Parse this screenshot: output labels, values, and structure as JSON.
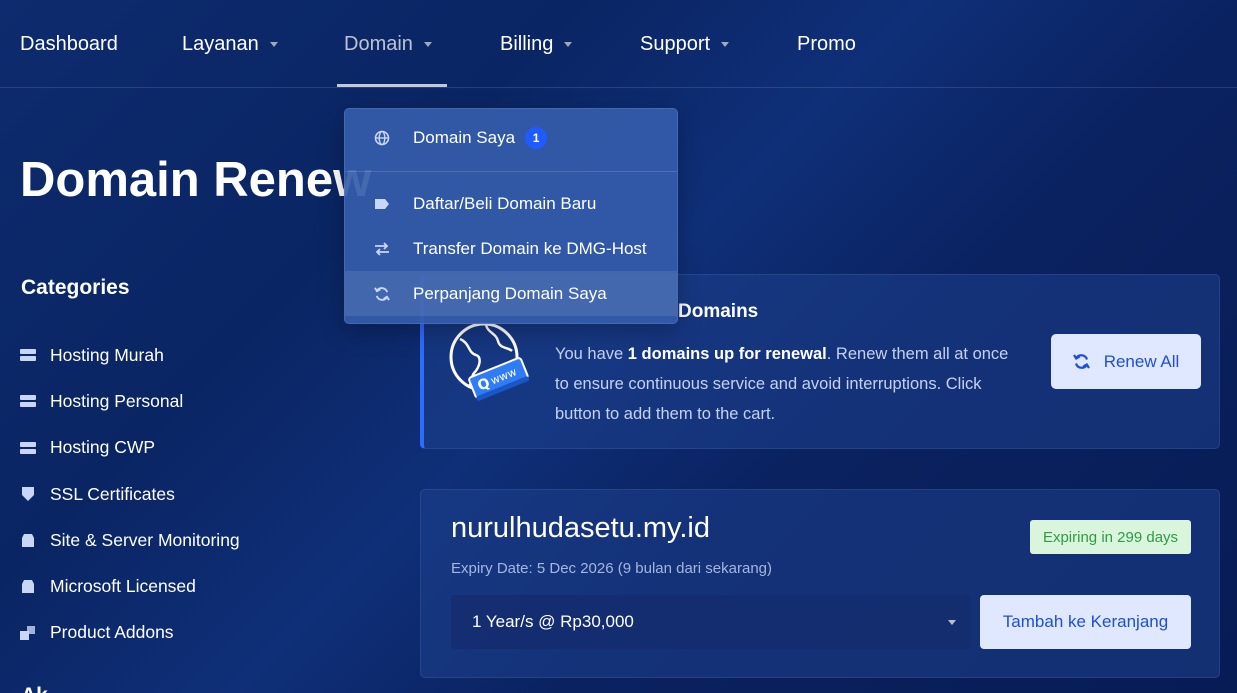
{
  "nav": {
    "items": [
      {
        "label": "Dashboard",
        "has_caret": false
      },
      {
        "label": "Layanan",
        "has_caret": true
      },
      {
        "label": "Domain",
        "has_caret": true,
        "active": true
      },
      {
        "label": "Billing",
        "has_caret": true
      },
      {
        "label": "Support",
        "has_caret": true
      },
      {
        "label": "Promo",
        "has_caret": false
      }
    ]
  },
  "dropdown": {
    "items": [
      {
        "label": "Domain Saya",
        "icon": "globe-icon",
        "badge": "1"
      },
      {
        "label": "Daftar/Beli Domain Baru",
        "icon": "tag-icon"
      },
      {
        "label": "Transfer Domain ke DMG-Host",
        "icon": "transfer-arrows-icon"
      },
      {
        "label": "Perpanjang Domain Saya",
        "icon": "sync-icon",
        "hovered": true
      }
    ]
  },
  "page": {
    "title": "Domain Renew"
  },
  "categories": {
    "title": "Categories",
    "items": [
      {
        "label": "Hosting Murah",
        "icon": "server-icon"
      },
      {
        "label": "Hosting Personal",
        "icon": "server-icon"
      },
      {
        "label": "Hosting CWP",
        "icon": "server-icon"
      },
      {
        "label": "SSL Certificates",
        "icon": "shield-icon"
      },
      {
        "label": "Site & Server Monitoring",
        "icon": "box-icon"
      },
      {
        "label": "Microsoft Licensed",
        "icon": "box-icon"
      },
      {
        "label": "Product Addons",
        "icon": "cubes-icon"
      }
    ],
    "next_section_title": "Ak"
  },
  "renew_card": {
    "title": "Domains",
    "text_prefix": "You have ",
    "text_bold": "1 domains up for renewal",
    "text_suffix": ". Renew them all at once to ensure continuous service and avoid interruptions. Click button to add them to the cart.",
    "button_label": "Renew All",
    "illustration": "globe-www-icon"
  },
  "domain_card": {
    "domain": "nurulhudasetu.my.id",
    "expiry": "Expiry Date: 5 Dec 2026 (9 bulan dari sekarang)",
    "badge": "Expiring in 299 days",
    "period_selected": "1 Year/s @ Rp30,000",
    "button_label": "Tambah ke Keranjang"
  },
  "colors": {
    "accent_blue": "#2f6bff",
    "button_bg": "#dfe8ff",
    "button_text": "#1f4ed8",
    "badge_bg": "#d9f5dc",
    "badge_text": "#2f9b44"
  }
}
